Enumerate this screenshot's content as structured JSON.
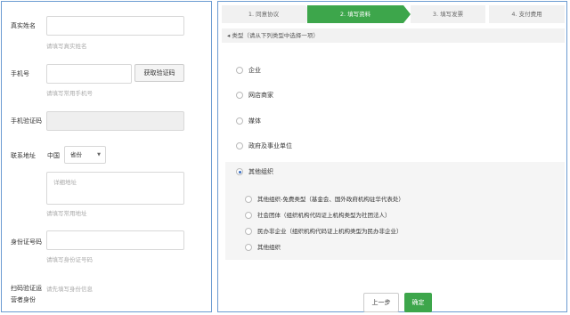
{
  "left_form": {
    "real_name": {
      "label": "真实姓名",
      "value": "",
      "hint": "请填写真实姓名"
    },
    "phone": {
      "label": "手机号",
      "value": "",
      "hint": "请填写常用手机号",
      "get_code_button": "获取验证码"
    },
    "sms_code": {
      "label": "手机验证码",
      "value": ""
    },
    "address": {
      "label": "联系地址",
      "country": "中国",
      "province_select": "省份",
      "detail_placeholder": "详细地址",
      "hint": "请填写常用地址"
    },
    "id_number": {
      "label": "身份证号码",
      "value": "",
      "hint": "请填写身份证号码"
    },
    "scan_verify": {
      "label_line1": "扫码验证运",
      "label_line2": "营者身份",
      "hint": "请先填写身份信息"
    }
  },
  "stepper": {
    "steps": [
      "1. 同意协议",
      "2. 填写资料",
      "3. 填写发票",
      "4. 支付费用"
    ],
    "active_index": 1
  },
  "type_section": {
    "header": "类型（请从下列类型中选择一项）",
    "options": [
      "企业",
      "网店商家",
      "媒体",
      "政府及事业单位",
      "其他组织"
    ],
    "selected": "其他组织",
    "sub_options": [
      "其他组织-免费类型（基金会、国外政府机构驻华代表处）",
      "社会团体（组织机构代码证上机构类型为社团法人）",
      "民办非企业（组织机构代码证上机构类型为民办非企业）",
      "其他组织"
    ]
  },
  "actions": {
    "prev": "上一步",
    "confirm": "确定"
  },
  "colors": {
    "accent": "#3da64b",
    "panel_border": "#6b9bd2"
  }
}
